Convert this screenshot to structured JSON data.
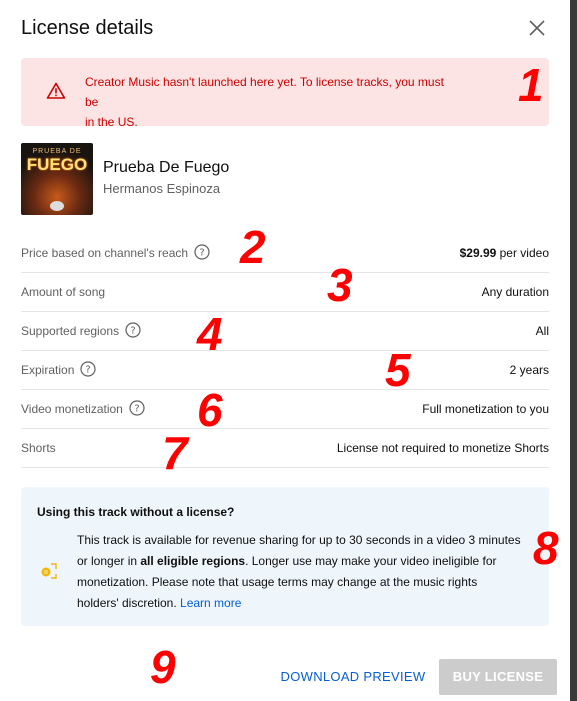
{
  "dialog": {
    "title": "License details"
  },
  "banner": {
    "line1": "Creator Music hasn't launched here yet. To license tracks, you must be",
    "line2": "in the US."
  },
  "track": {
    "title": "Prueba De Fuego",
    "artist": "Hermanos Espinoza",
    "art_small_text": "PRUEBA DE",
    "art_big_text": "FUEGO"
  },
  "details": [
    {
      "label": "Price based on channel's reach",
      "help": true,
      "value_bold": "$29.99",
      "value": " per video"
    },
    {
      "label": "Amount of song",
      "help": false,
      "value_bold": "",
      "value": "Any duration"
    },
    {
      "label": "Supported regions",
      "help": true,
      "value_bold": "",
      "value": "All"
    },
    {
      "label": "Expiration",
      "help": true,
      "value_bold": "",
      "value": "2 years"
    },
    {
      "label": "Video monetization",
      "help": true,
      "value_bold": "",
      "value": "Full monetization to you"
    },
    {
      "label": "Shorts",
      "help": false,
      "value_bold": "",
      "value": "License not required to monetize Shorts"
    }
  ],
  "info": {
    "title": "Using this track without a license?",
    "text_before": "This track is available for revenue sharing for up to 30 seconds in a video 3 minutes or longer in ",
    "text_bold": "all eligible regions",
    "text_after": ". Longer use may make your video ineligible for monetization. Please note that usage terms may change at the music rights holders' discretion. ",
    "link": "Learn more"
  },
  "footer": {
    "preview_label": "DOWNLOAD PREVIEW",
    "buy_label": "BUY LICENSE"
  },
  "annotations": [
    "1",
    "2",
    "3",
    "4",
    "5",
    "6",
    "7",
    "8",
    "9"
  ],
  "colors": {
    "warning_bg": "#fde4e4",
    "warning_text": "#cc0000",
    "link": "#065fd4",
    "info_bg": "#eef5fb",
    "disabled_button": "#cccccc",
    "annotation": "#ff0000",
    "info_icon": "#f2b705"
  }
}
